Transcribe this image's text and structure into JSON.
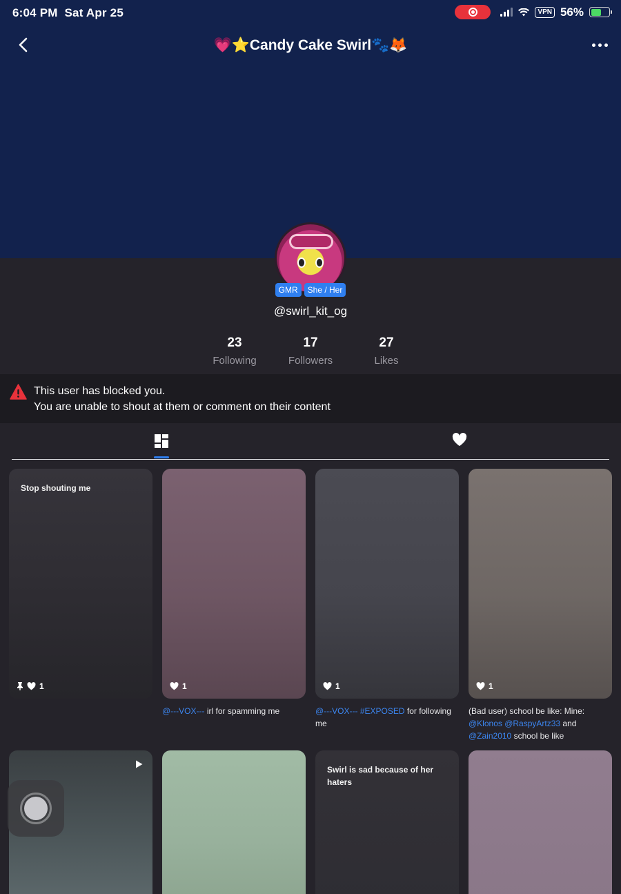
{
  "status_bar": {
    "time": "6:04 PM",
    "date": "Sat Apr 25",
    "vpn_label": "VPN",
    "battery_percent": "56%",
    "battery_level": 0.56
  },
  "header": {
    "title": "💗⭐Candy Cake Swirl🐾🦊",
    "back_icon": "chevron-left-icon",
    "more_icon": "ellipsis-icon"
  },
  "profile": {
    "badges": [
      "GMR",
      "She / Her"
    ],
    "username": "@swirl_kit_og",
    "stats": [
      {
        "value": "23",
        "label": "Following"
      },
      {
        "value": "17",
        "label": "Followers"
      },
      {
        "value": "27",
        "label": "Likes"
      }
    ]
  },
  "blocked_notice": {
    "line1": "This user has blocked you.",
    "line2": "You are unable to shout at them or comment on their content"
  },
  "tabs": [
    {
      "icon": "grid-icon",
      "active": true
    },
    {
      "icon": "heart-icon",
      "active": false
    }
  ],
  "posts": [
    {
      "text": "Stop shouting me",
      "likes": "1",
      "pinned": true,
      "caption": ""
    },
    {
      "text": "",
      "likes": "1",
      "pinned": false,
      "caption_mention": "@---VOX---",
      "caption_rest": " irl for spamming me"
    },
    {
      "text": "",
      "likes": "1",
      "pinned": false,
      "caption_mention": "@---VOX---",
      "caption_tag": " #EXPOSED",
      "caption_rest": " for following me"
    },
    {
      "text": "",
      "likes": "1",
      "pinned": false,
      "caption_start": "(Bad user) school be like: Mine: ",
      "caption_m1": "@Klonos",
      "caption_m2": " @RaspyArtz33",
      "caption_and": " and ",
      "caption_m3": "@Zain2010",
      "caption_end": " school be like"
    },
    {
      "text": "",
      "video": true
    },
    {
      "text": ""
    },
    {
      "text": "Swirl is sad because of her haters"
    },
    {
      "text": ""
    }
  ],
  "colors": {
    "banner": "#12224d",
    "background": "#25232a",
    "accent": "#2f7ff0",
    "warning": "#e8323b"
  }
}
